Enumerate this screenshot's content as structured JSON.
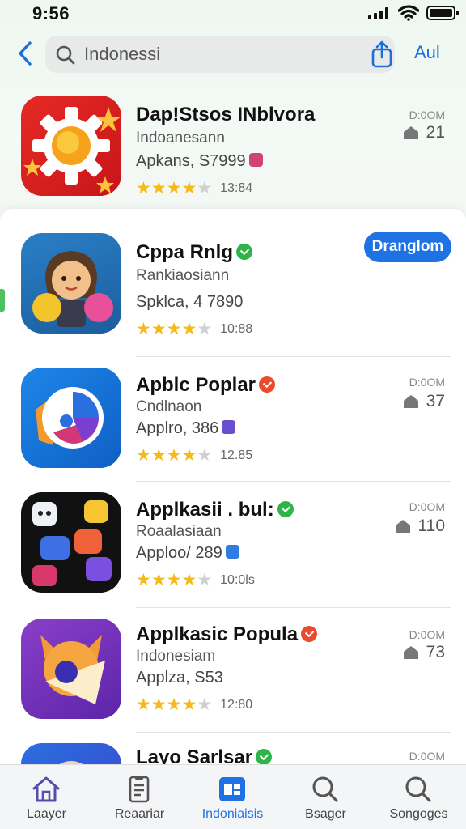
{
  "status_bar": {
    "time": "9:56"
  },
  "header": {
    "search_value": "Indonessi",
    "cancel_label": "Aul"
  },
  "accent_color": "#1f72e3",
  "apps": [
    {
      "name": "Dap!Stsos INblvora",
      "subtitle": "Indoanesann",
      "meta": "Apkans, S7999",
      "rating_stars": 4,
      "rating_count": "13:84",
      "size_label": "D:0OM",
      "get_count": "21",
      "badge": "none",
      "icon": "sun-gear-icon"
    },
    {
      "name": "Cppa Rnlg",
      "subtitle": "Rankiaosiann",
      "meta": "Spklca, 4 7890",
      "rating_stars": 4,
      "rating_count": "10:88",
      "action_label": "Dranglom",
      "badge": "green",
      "icon": "character-icon"
    },
    {
      "name": "Apblc Poplar",
      "subtitle": "Cndlnaon",
      "meta": "Applro, 386",
      "rating_stars": 4,
      "rating_count": "12.85",
      "size_label": "D:0OM",
      "get_count": "37",
      "badge": "red",
      "icon": "circle-swirl-icon"
    },
    {
      "name": "Applkasii . bul:",
      "subtitle": "Roaalasiaan",
      "meta": "Apploo/ 289",
      "rating_stars": 4,
      "rating_count": "10:0ls",
      "size_label": "D:0OM",
      "get_count": "110",
      "badge": "green",
      "icon": "app-grid-icon"
    },
    {
      "name": "Applkasic Popula",
      "subtitle": "Indonesiam",
      "meta": "Applza, S53",
      "rating_stars": 4,
      "rating_count": "12:80",
      "size_label": "D:0OM",
      "get_count": "73",
      "badge": "red",
      "icon": "fox-icon"
    },
    {
      "name": "Layo Sarlsar",
      "size_label": "D:0OM",
      "badge": "green",
      "icon": "partial-icon"
    }
  ],
  "tabs": [
    {
      "label": "Laayer",
      "icon": "home-icon"
    },
    {
      "label": "Reaariar",
      "icon": "document-icon"
    },
    {
      "label": "Indoniaisis",
      "icon": "apps-icon",
      "active": true
    },
    {
      "label": "Bsager",
      "icon": "search-icon"
    },
    {
      "label": "Songoges",
      "icon": "search-icon"
    }
  ]
}
